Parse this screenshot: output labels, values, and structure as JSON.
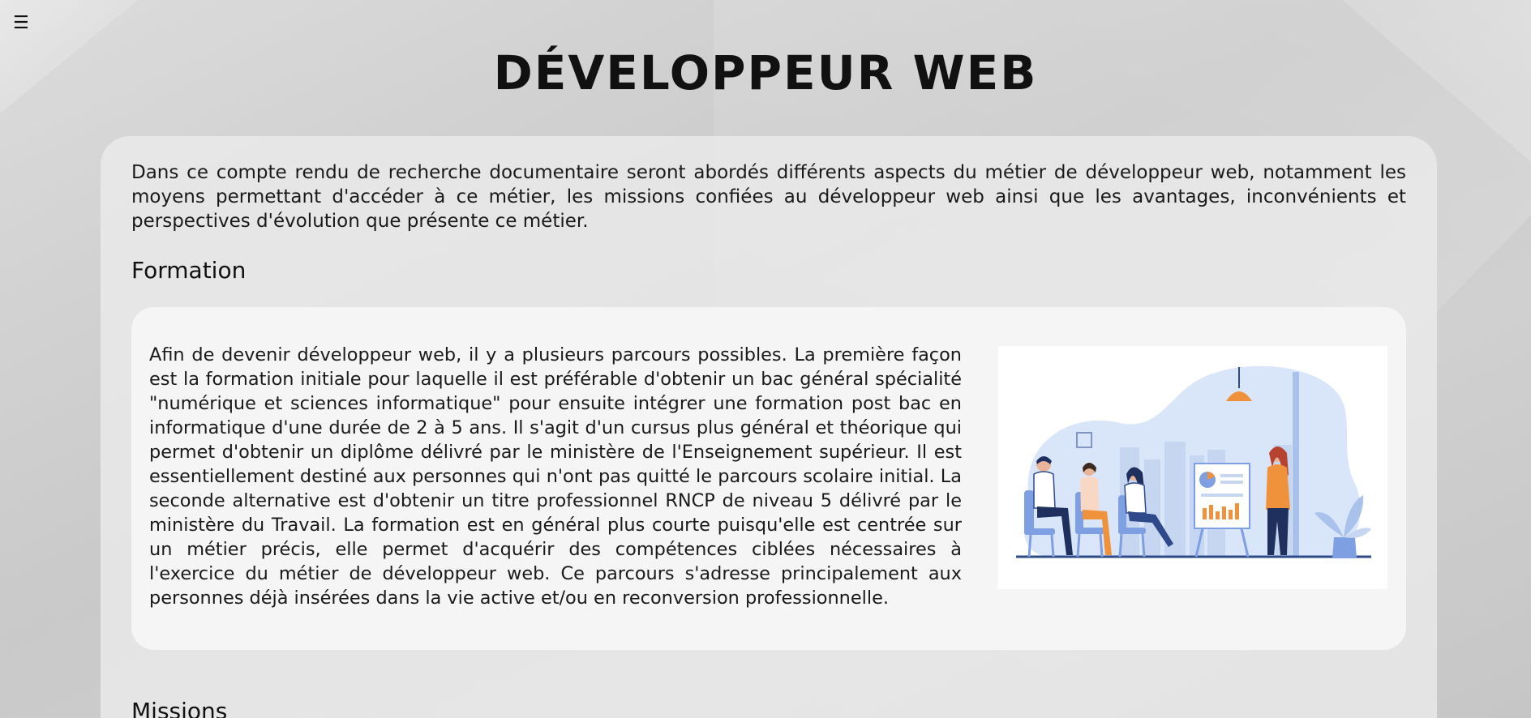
{
  "header": {
    "menu_icon": "☰",
    "title": "DÉVELOPPEUR WEB"
  },
  "intro": {
    "text": "Dans ce compte rendu de recherche documentaire seront abordés différents aspects du métier de développeur web, notamment les moyens permettant d'accéder à ce métier, les missions confiées au développeur web ainsi que les avantages, inconvénients et perspectives d'évolution que présente ce métier."
  },
  "sections": {
    "formation": {
      "heading": "Formation",
      "text": "Afin de devenir développeur web, il y a plusieurs parcours possibles. La première façon est la formation initiale pour laquelle il est préférable d'obtenir un bac général spécialité \"numérique et sciences informatique\" pour ensuite intégrer une formation post bac en informatique d'une durée de 2 à 5 ans. Il s'agit d'un cursus plus général et théorique qui permet d'obtenir un diplôme délivré par le ministère de l'Enseignement supérieur. Il est essentiellement destiné aux personnes qui n'ont pas quitté le parcours scolaire initial. La seconde alternative est d'obtenir un titre professionnel RNCP de niveau 5 délivré par le ministère du Travail. La formation est en général plus courte puisqu'elle est centrée sur un métier précis, elle permet d'acquérir des compétences ciblées nécessaires à l'exercice du métier de développeur web. Ce parcours s'adresse principalement aux personnes déjà insérées dans la vie active et/ou en reconversion professionnelle.",
      "illustration_icon": "training-presentation-illustration"
    },
    "missions": {
      "heading": "Missions"
    }
  },
  "colors": {
    "accent_blue": "#2f4a8a",
    "light_blue": "#d6e3f8",
    "orange": "#f0923b",
    "text": "#111111"
  }
}
